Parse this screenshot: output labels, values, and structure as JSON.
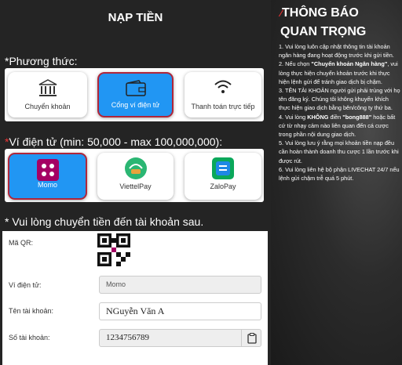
{
  "deposit": {
    "title": "NẠP TIỀN",
    "method_label": "*Phương thức:",
    "methods": [
      {
        "label": "Chuyển khoản",
        "icon": "bank-icon",
        "selected": false
      },
      {
        "label": "Cổng ví điện tử",
        "icon": "wallet-icon",
        "selected": true
      },
      {
        "label": "Thanh toán trực tiếp",
        "icon": "wifi-icon",
        "selected": false
      }
    ],
    "wallet_label_star": "*",
    "wallet_label": "Ví điện tử (min: 50,000 - max 100,000,000):",
    "wallets": [
      {
        "label": "Momo",
        "logo": "momo",
        "selected": true
      },
      {
        "label": "ViettelPay",
        "logo": "viettelpay",
        "selected": false
      },
      {
        "label": "ZaloPay",
        "logo": "zalopay",
        "selected": false
      }
    ],
    "transfer_label": "* Vui lòng chuyển tiền đến tài khoản sau.",
    "fields": {
      "qr_label": "Mã QR:",
      "wallet_field_label": "Ví điện tử:",
      "wallet_field_value": "Momo",
      "account_name_label": "Tên tài khoản:",
      "account_name_value": "NGuyễn Văn A",
      "account_number_label": "Số tài khoản:",
      "account_number_value": "1234756789"
    }
  },
  "notice": {
    "title": "THÔNG BÁO QUAN TRỌNG",
    "item1": "1. Vui lòng luôn cập nhật thông tin tài khoản ngân hàng đang hoạt động trước khi gửi tiền.",
    "item2_pre": "2. Nếu chọn ",
    "item2_bold": "\"Chuyển khoản Ngân hàng\"",
    "item2_post": ", vui lòng thực hiện chuyển khoản trước khi thực hiện lệnh gửi để tránh giao dịch bị chậm.",
    "item3": "3. TÊN TÀI KHOẢN người gửi phải trùng với họ tên đăng ký. Chúng tôi không khuyến khích thực hiện giao dịch bằng bên/công ty thứ ba.",
    "item4_pre": "4. Vui lòng ",
    "item4_bold1": "KHÔNG",
    "item4_mid": " điền ",
    "item4_bold2": "\"bong888\"",
    "item4_post": " hoặc bất cứ từ nhạy cảm nào liên quan đến cá cược trong phần nội dung giao dịch.",
    "item5": "5. Vui lòng lưu ý rằng mọi khoản tiền nạp đều cần hoàn thành doanh thu cược 1 lần trước khi được rút.",
    "item6": "6. Vui lòng liên hệ bộ phận LIVECHAT 24/7 nếu lệnh gửi chậm trễ quá 5 phút."
  },
  "colors": {
    "selected": "#2196f3",
    "selected_border": "#b0263a",
    "momo": "#a50064",
    "accent_red": "#e33333"
  }
}
